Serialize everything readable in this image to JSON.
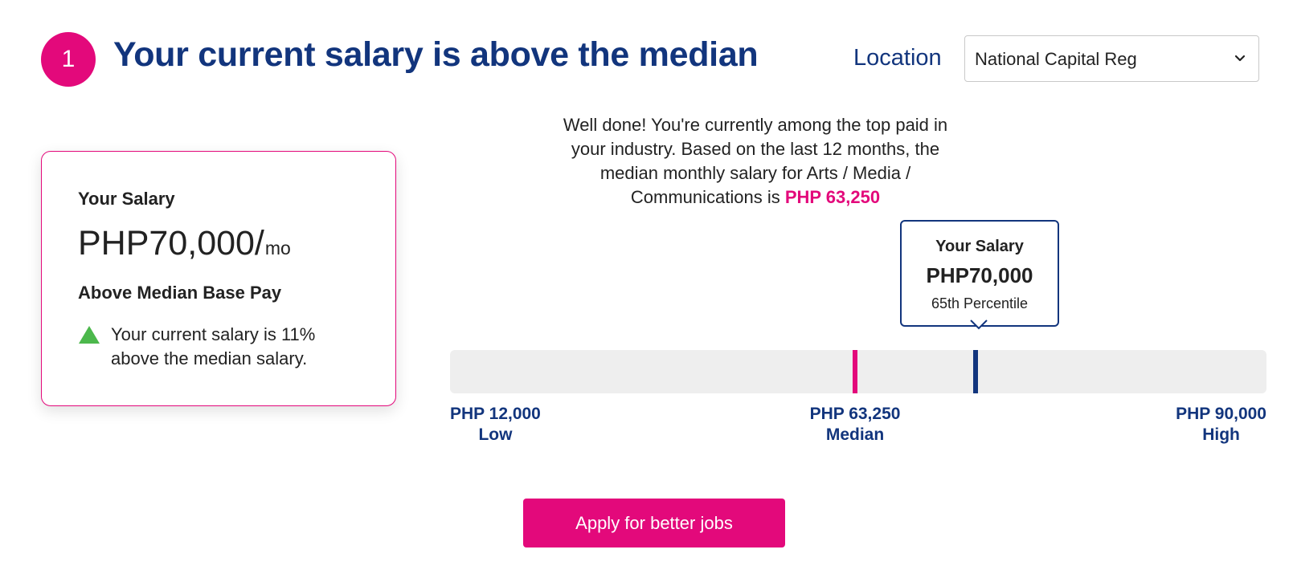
{
  "header": {
    "step_number": "1",
    "title": "Your current salary is above the median"
  },
  "location": {
    "label": "Location",
    "selected": "National Capital Reg"
  },
  "salary_card": {
    "label": "Your Salary",
    "amount": "PHP70,000/",
    "unit": "mo",
    "status": "Above Median Base Pay",
    "note": "Your current salary is 11% above the median salary.",
    "indicator_icon": "triangle-up-icon",
    "indicator_color": "#4cb84c"
  },
  "message": {
    "line1": "Well done! You're currently among the top paid in your industry.",
    "line2": "Based on the last 12 months, the median monthly salary for Arts / Media / Communications is",
    "highlight": "PHP 63,250"
  },
  "tooltip": {
    "title": "Your Salary",
    "amount": "PHP70,000",
    "percentile": "65th Percentile"
  },
  "range": {
    "low_value": "PHP 12,000",
    "low_label": "Low",
    "median_value": "PHP 63,250",
    "median_label": "Median",
    "high_value": "PHP 90,000",
    "high_label": "High",
    "low_number": 12000,
    "median_number": 63250,
    "high_number": 90000,
    "your_number": 70000
  },
  "cta": {
    "label": "Apply for better jobs"
  },
  "colors": {
    "brand_pink": "#e3097b",
    "brand_navy": "#12357d",
    "track_gray": "#eeeeee"
  }
}
